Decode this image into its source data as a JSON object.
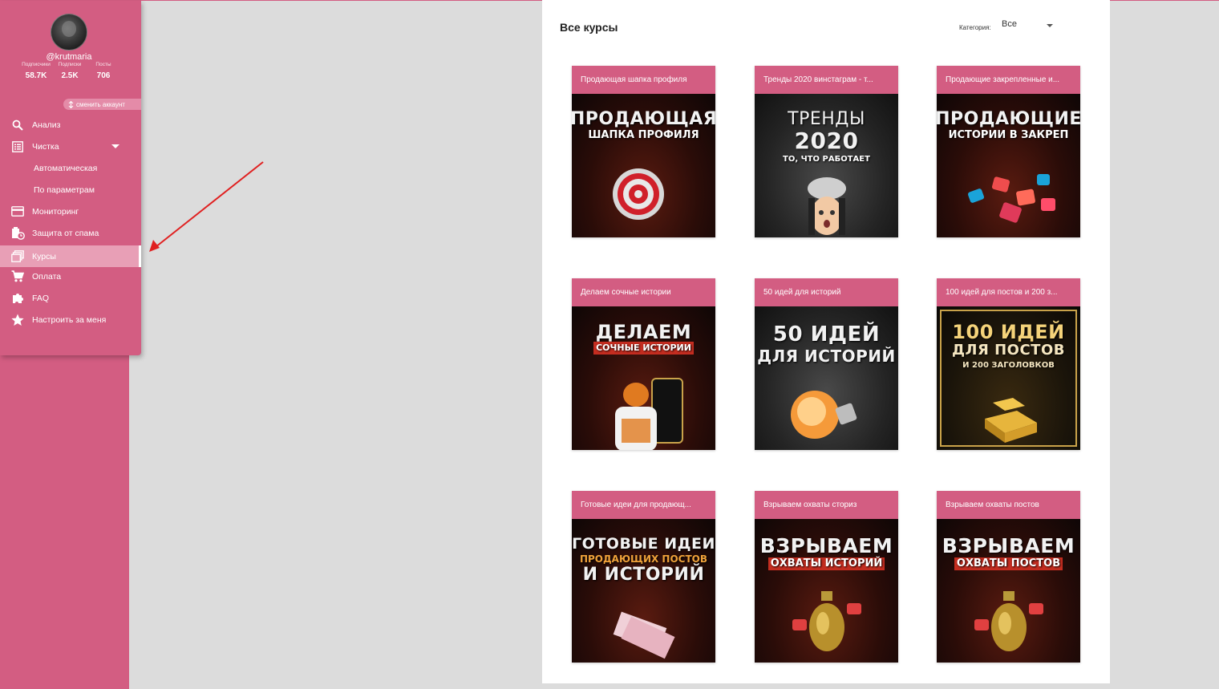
{
  "profile": {
    "username": "@krutmaria",
    "stats": [
      {
        "label": "Подписчики",
        "value": "58.7K"
      },
      {
        "label": "Подписки",
        "value": "2.5K"
      },
      {
        "label": "Посты",
        "value": "706"
      }
    ],
    "switch_label": "сменить аккаунт"
  },
  "menu": {
    "analysis": "Анализ",
    "cleaning": "Чистка",
    "auto": "Автоматическая",
    "by_params": "По параметрам",
    "monitoring": "Мониторинг",
    "spam": "Защита от спама",
    "courses": "Курсы",
    "payment": "Оплата",
    "faq": "FAQ",
    "setup": "Настроить за меня"
  },
  "main": {
    "title": "Все курсы",
    "category_label": "Категория:",
    "category_value": "Все"
  },
  "courses": [
    {
      "title": "Продающая шапка профиля",
      "line1": "ПРОДАЮЩАЯ",
      "line2": "ШАПКА ПРОФИЛЯ"
    },
    {
      "title": "Тренды 2020 винстаграм - т...",
      "line1": "ТРЕНДЫ",
      "line2": "2020",
      "line3": "ТО, ЧТО РАБОТАЕТ"
    },
    {
      "title": "Продающие закрепленные и...",
      "line1": "ПРОДАЮЩИЕ",
      "line2": "ИСТОРИИ В ЗАКРЕП"
    },
    {
      "title": "Делаем сочные истории",
      "line1": "ДЕЛАЕМ",
      "line2": "СОЧНЫЕ ИСТОРИИ"
    },
    {
      "title": "50 идей для историй",
      "line1": "50 ИДЕЙ",
      "line2": "ДЛЯ ИСТОРИЙ"
    },
    {
      "title": "100 идей для постов и 200 з...",
      "line1": "100 ИДЕЙ",
      "line2": "ДЛЯ ПОСТОВ",
      "line3": "И 200 ЗАГОЛОВКОВ"
    },
    {
      "title": "Готовые идеи для продающ...",
      "line1": "ГОТОВЫЕ ИДЕИ",
      "line2": "ПРОДАЮЩИХ ПОСТОВ",
      "line3": "И ИСТОРИЙ"
    },
    {
      "title": "Взрываем охваты сториз",
      "line1": "ВЗРЫВАЕМ",
      "line2": "ОХВАТЫ ИСТОРИЙ"
    },
    {
      "title": "Взрываем охваты постов",
      "line1": "ВЗРЫВАЕМ",
      "line2": "ОХВАТЫ ПОСТОВ"
    }
  ],
  "colors": {
    "brand": "#d35d82",
    "active_item": "#e89fb6",
    "background": "#dcdcdc",
    "arrow": "#e02020"
  }
}
